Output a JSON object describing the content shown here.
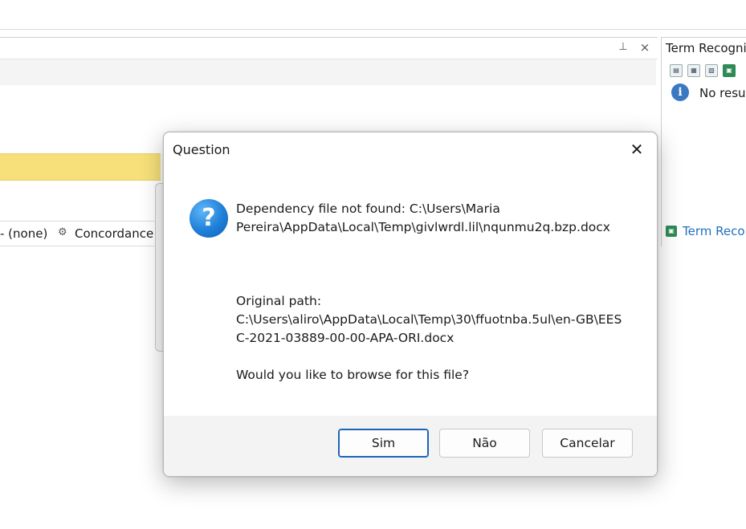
{
  "background": {
    "bottom_tabs": {
      "none_tab": "- (none)",
      "concordance_tab": "Concordance"
    },
    "right_panel": {
      "title": "Term Recogni",
      "no_results": "No resul",
      "tab_label": "Term Reco"
    },
    "icons": {
      "pin": "pin-icon",
      "close": "close-icon",
      "info": "info-icon",
      "concordance": "concordance-icon"
    }
  },
  "dialog": {
    "title": "Question",
    "close_glyph": "✕",
    "message_lines": [
      "Dependency file not found: C:\\Users\\Maria",
      "Pereira\\AppData\\Local\\Temp\\givlwrdl.lil\\nqunmu2q.bzp.docx",
      "Original path:",
      "C:\\Users\\aliro\\AppData\\Local\\Temp\\30\\ffuotnba.5ul\\en-GB\\EES",
      "C-2021-03889-00-00-APA-ORI.docx",
      "Would you like to browse for this file?"
    ],
    "buttons": {
      "yes": "Sim",
      "no": "Não",
      "cancel": "Cancelar"
    }
  },
  "colors": {
    "accent": "#1c64b8",
    "question_icon": "#1f7fd8",
    "highlight_bar": "#f7e07a",
    "term_link": "#1f6fbf"
  }
}
